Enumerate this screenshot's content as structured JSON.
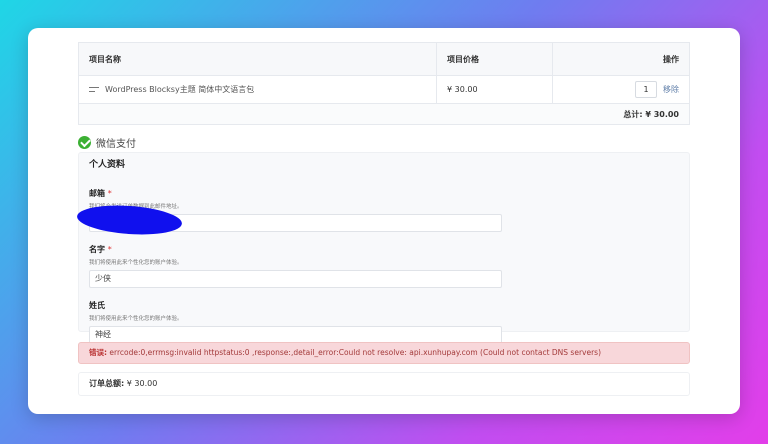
{
  "cart": {
    "headers": {
      "name": "项目名称",
      "price": "项目价格",
      "action": "操作"
    },
    "items": [
      {
        "name": "WordPress Blocksy主题 简体中文语言包",
        "price": "¥ 30.00",
        "qty": "1",
        "remove": "移除"
      }
    ],
    "total": "总计: ¥ 30.00"
  },
  "payment": {
    "method": "微信支付",
    "icon": "wechat-pay-icon",
    "color": "#3cb034"
  },
  "profile": {
    "title": "个人资料",
    "email": {
      "label": "邮箱",
      "required": "*",
      "help": "我们将会发送订单数据到此邮件地址。",
      "value": ""
    },
    "first_name": {
      "label": "名字",
      "required": "*",
      "help": "我们将使用此来个性化您的账户体验。",
      "value": "少侠"
    },
    "last_name": {
      "label": "姓氏",
      "help": "我们将使用此来个性化您的账户体验。",
      "value": "神经"
    }
  },
  "error": {
    "label": "错误:",
    "message": " errcode:0,errmsg:invalid httpstatus:0 ,response:,detail_error:Could not resolve: api.xunhupay.com (Could not contact DNS servers)",
    "color": "#a33a3a"
  },
  "order_total": {
    "label": "订单总额:",
    "value": "¥ 30.00"
  }
}
